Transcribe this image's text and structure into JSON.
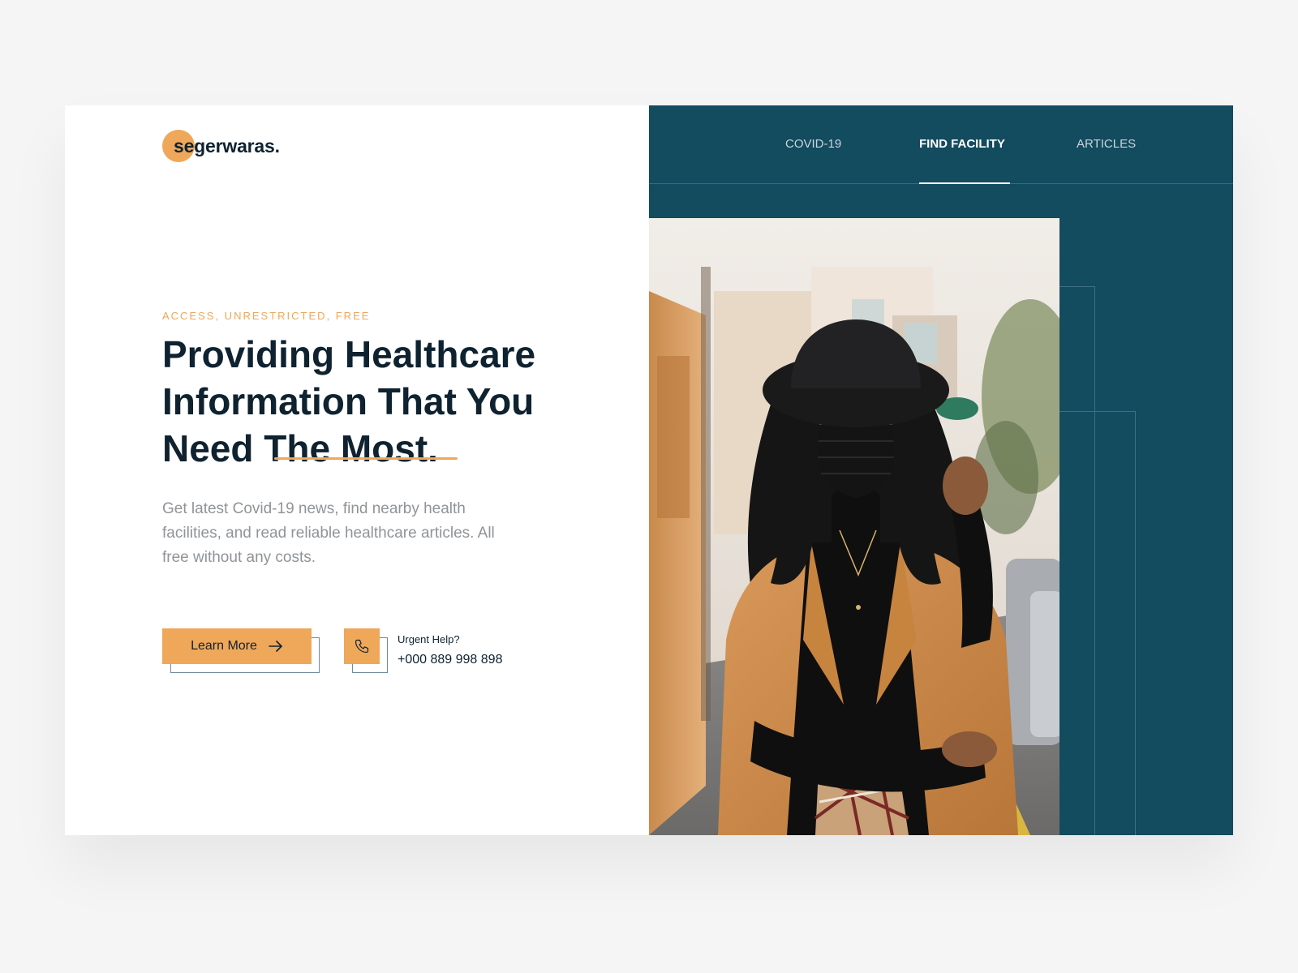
{
  "brand": {
    "name": "segerwaras.",
    "accent_color": "#efa75a",
    "dark_color": "#0e2230",
    "panel_color": "#134b5f"
  },
  "nav": {
    "items": [
      {
        "label": "COVID-19",
        "active": false
      },
      {
        "label": "FIND FACILITY",
        "active": true
      },
      {
        "label": "ARTICLES",
        "active": false
      }
    ]
  },
  "hero": {
    "eyebrow": "ACCESS, UNRESTRICTED, FREE",
    "headline": "Providing Healthcare Information That You Need The Most.",
    "description": "Get latest Covid-19 news, find nearby health facilities, and read reliable healthcare articles. All free without any costs.",
    "cta_label": "Learn More",
    "cta_icon": "arrow-right-icon"
  },
  "contact": {
    "icon": "phone-icon",
    "label": "Urgent Help?",
    "number": "+000 889 998 898"
  },
  "photo": {
    "subject": "woman-wearing-mask-photo"
  }
}
